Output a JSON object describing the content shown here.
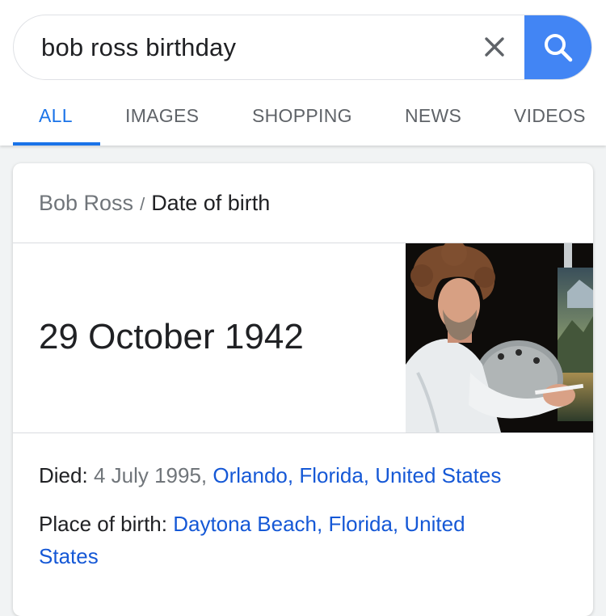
{
  "search": {
    "query": "bob ross birthday"
  },
  "tabs": [
    {
      "label": "ALL",
      "active": true
    },
    {
      "label": "IMAGES"
    },
    {
      "label": "SHOPPING"
    },
    {
      "label": "NEWS"
    },
    {
      "label": "VIDEOS"
    }
  ],
  "card": {
    "breadcrumb": {
      "entity": "Bob Ross",
      "separator": "/",
      "attribute": "Date of birth"
    },
    "answer": "29 October 1942",
    "died": {
      "label": "Died:",
      "date": "4 July 1995,",
      "place": "Orlando, Florida, United States"
    },
    "place_of_birth": {
      "label": "Place of birth:",
      "place": "Daytona Beach, Florida, United States"
    }
  },
  "colors": {
    "accent": "#1a73e8",
    "search_button": "#4285f4",
    "link": "#1558d6"
  },
  "icons": [
    "clear-icon",
    "search-icon"
  ]
}
